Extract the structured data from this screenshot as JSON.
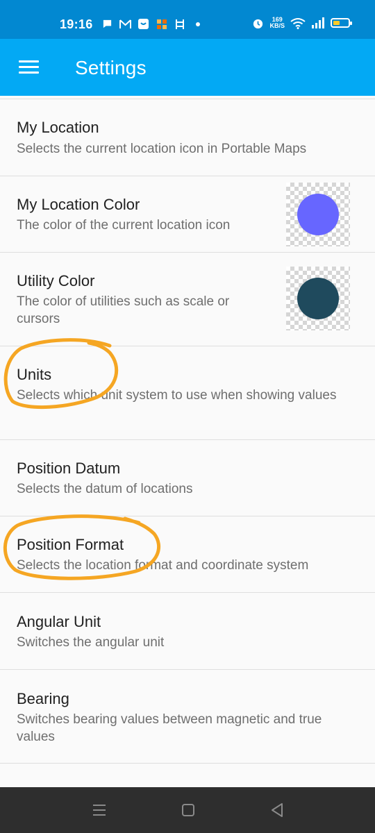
{
  "status_bar": {
    "time": "19:16",
    "net_speed_value": "169",
    "net_speed_unit": "KB/S",
    "icons": [
      "chat-icon",
      "gmail-icon",
      "app-icon",
      "puzzle-icon",
      "book-icon",
      "dot-icon",
      "alarm-icon",
      "wifi-icon",
      "signal-icon",
      "battery-icon"
    ]
  },
  "app_bar": {
    "title": "Settings",
    "menu_icon": "hamburger-menu-icon"
  },
  "settings": [
    {
      "title": "My Location",
      "subtitle": "Selects the current location icon in Portable Maps"
    },
    {
      "title": "My Location Color",
      "subtitle": "The color of the current location icon",
      "color": "#6766ff"
    },
    {
      "title": "Utility Color",
      "subtitle": "The color of utilities such as scale or cursors",
      "color": "#1f4a5d"
    },
    {
      "title": "Units",
      "subtitle": "Selects which unit system to use when showing values"
    },
    {
      "title": "Position Datum",
      "subtitle": "Selects the datum of locations"
    },
    {
      "title": "Position Format",
      "subtitle": "Selects the location format and coordinate system"
    },
    {
      "title": "Angular Unit",
      "subtitle": "Switches the angular unit"
    },
    {
      "title": "Bearing",
      "subtitle": "Switches bearing values between magnetic and true values"
    }
  ],
  "colors": {
    "status_bar": "#0288d1",
    "app_bar": "#03a9f4",
    "annotation": "#f5a623",
    "nav_bar": "#2e2e2e"
  },
  "nav_bar": {
    "icons": [
      "recents-icon",
      "home-icon",
      "back-icon"
    ]
  }
}
